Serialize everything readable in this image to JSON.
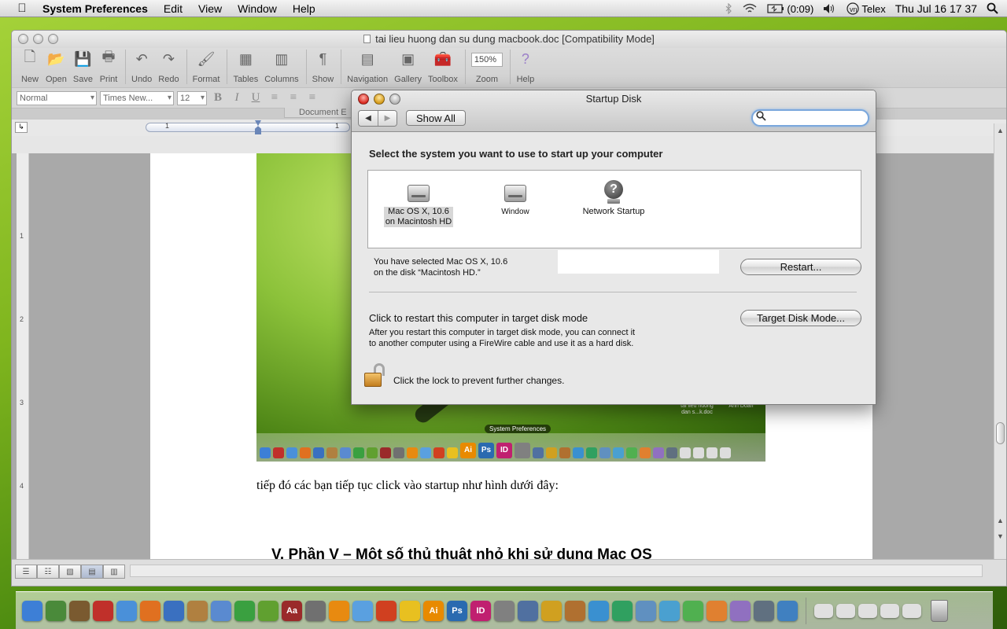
{
  "menubar": {
    "app_name": "System Preferences",
    "items": [
      "Edit",
      "View",
      "Window",
      "Help"
    ],
    "battery": "(0:09)",
    "input_method": "Telex",
    "datetime": "Thu Jul 16  17 37"
  },
  "word": {
    "window_title": "tai lieu huong dan su dung macbook.doc [Compatibility Mode]",
    "toolbar": [
      {
        "label": "New",
        "icon": "new-document-icon"
      },
      {
        "label": "Open",
        "icon": "open-folder-icon"
      },
      {
        "label": "Save",
        "icon": "save-disk-icon"
      },
      {
        "label": "Print",
        "icon": "printer-icon"
      },
      {
        "label": "Undo",
        "icon": "undo-icon"
      },
      {
        "label": "Redo",
        "icon": "redo-icon"
      },
      {
        "label": "Format",
        "icon": "format-brush-icon"
      },
      {
        "label": "Tables",
        "icon": "table-icon"
      },
      {
        "label": "Columns",
        "icon": "columns-icon"
      },
      {
        "label": "Show",
        "icon": "pilcrow-icon"
      },
      {
        "label": "Navigation",
        "icon": "navigation-pane-icon"
      },
      {
        "label": "Gallery",
        "icon": "gallery-icon"
      },
      {
        "label": "Toolbox",
        "icon": "toolbox-icon"
      },
      {
        "label": "Zoom",
        "value": "150%"
      },
      {
        "label": "Help",
        "icon": "help-icon"
      }
    ],
    "format": {
      "style": "Normal",
      "font": "Times New...",
      "size": "12"
    },
    "ribbon_tab": "Document E",
    "ruler_marks": [
      "1",
      "1"
    ],
    "vruler_marks": [
      "1",
      "2",
      "3",
      "4"
    ],
    "embedded": {
      "dock_label": "System Preferences",
      "file1": "tai lieu huong dan s...k.doc",
      "file2": "Anh Doan"
    },
    "paragraph": "tiếp đó các bạn tiếp tục click vào startup như hình dưới đây:",
    "heading": "V.   Phần V – Một số thủ thuật nhỏ khi sử dụng Mac OS"
  },
  "prefs": {
    "title": "Startup Disk",
    "show_all": "Show All",
    "search_placeholder": "",
    "prompt": "Select the system you want to use to start up your computer",
    "disks": [
      {
        "line1": "Mac OS X, 10.6",
        "line2": "on Macintosh HD",
        "selected": true
      },
      {
        "line1": "Window",
        "line2": "",
        "selected": false
      },
      {
        "line1": "Network Startup",
        "line2": "",
        "selected": false
      }
    ],
    "selected_msg_line1": "You have selected Mac OS X, 10.6",
    "selected_msg_line2": "on the disk “Macintosh HD.”",
    "restart_button": "Restart...",
    "tdm_title": "Click to restart this computer in target disk mode",
    "tdm_desc_line1": "After you restart this computer in target disk mode, you can connect it",
    "tdm_desc_line2": "to another computer using a FireWire cable and use it as a hard disk.",
    "tdm_button": "Target Disk Mode...",
    "lock_text": "Click the lock to prevent further changes."
  },
  "dock": {
    "apps": [
      {
        "name": "finder",
        "color": "#3d7fd6",
        "text": ""
      },
      {
        "name": "system-monitor",
        "color": "#4a8a3a",
        "text": ""
      },
      {
        "name": "app-3",
        "color": "#7a5a30",
        "text": ""
      },
      {
        "name": "app-4",
        "color": "#c0302a",
        "text": ""
      },
      {
        "name": "safari",
        "color": "#4a90d9",
        "text": ""
      },
      {
        "name": "firefox",
        "color": "#e07020",
        "text": ""
      },
      {
        "name": "chrome",
        "color": "#3a70c0",
        "text": ""
      },
      {
        "name": "address-book",
        "color": "#b08040",
        "text": ""
      },
      {
        "name": "app-9",
        "color": "#5a8ad0",
        "text": ""
      },
      {
        "name": "utorrent",
        "color": "#3aa040",
        "text": ""
      },
      {
        "name": "app-11",
        "color": "#60a030",
        "text": ""
      },
      {
        "name": "dictionary",
        "color": "#9a2a2a",
        "text": "Aa"
      },
      {
        "name": "app-13",
        "color": "#707070",
        "text": ""
      },
      {
        "name": "vlc",
        "color": "#e88a10",
        "text": ""
      },
      {
        "name": "itunes",
        "color": "#5aa0e0",
        "text": ""
      },
      {
        "name": "app-16",
        "color": "#d04020",
        "text": ""
      },
      {
        "name": "adium",
        "color": "#e8c020",
        "text": ""
      },
      {
        "name": "illustrator",
        "color": "#e88a00",
        "text": "Ai"
      },
      {
        "name": "photoshop",
        "color": "#2a6ab0",
        "text": "Ps"
      },
      {
        "name": "indesign",
        "color": "#c02070",
        "text": "ID"
      },
      {
        "name": "system-preferences",
        "color": "#808080",
        "text": ""
      },
      {
        "name": "app-22",
        "color": "#5070a0",
        "text": ""
      },
      {
        "name": "app-23",
        "color": "#d0a020",
        "text": ""
      },
      {
        "name": "app-24",
        "color": "#b07030",
        "text": ""
      },
      {
        "name": "app-25",
        "color": "#3a90d0",
        "text": ""
      },
      {
        "name": "app-26",
        "color": "#30a060",
        "text": ""
      },
      {
        "name": "app-27",
        "color": "#6090c0",
        "text": ""
      },
      {
        "name": "app-28",
        "color": "#4aa0d0",
        "text": ""
      },
      {
        "name": "app-29",
        "color": "#50b050",
        "text": ""
      },
      {
        "name": "app-30",
        "color": "#e08030",
        "text": ""
      },
      {
        "name": "app-31",
        "color": "#9070c0",
        "text": ""
      },
      {
        "name": "app-32",
        "color": "#607080",
        "text": ""
      },
      {
        "name": "app-33",
        "color": "#4080c0",
        "text": ""
      }
    ]
  }
}
